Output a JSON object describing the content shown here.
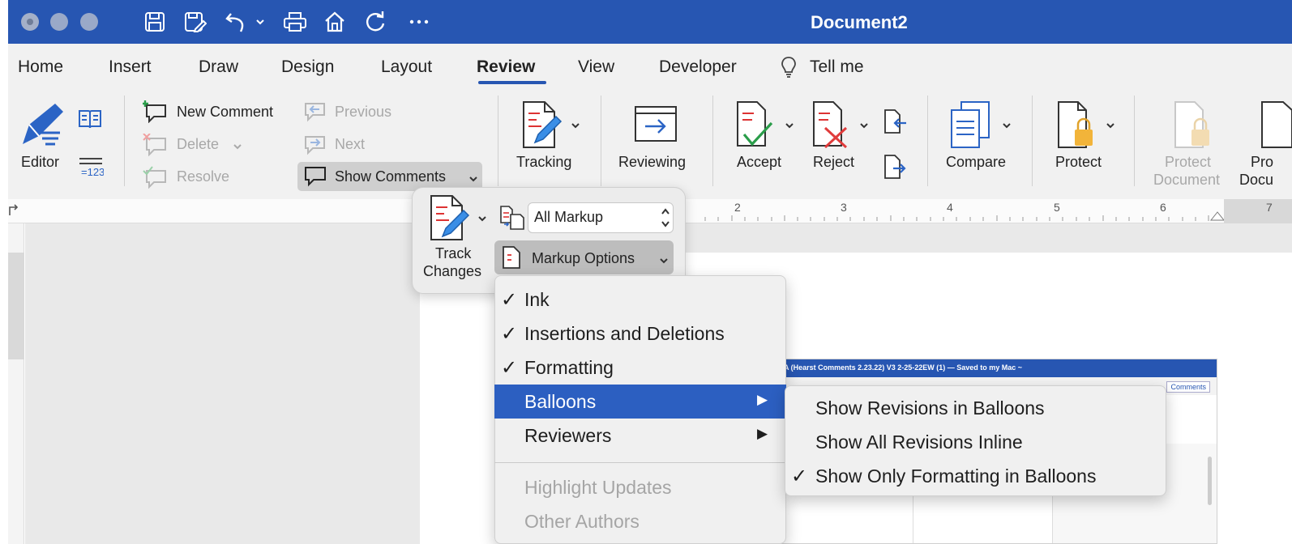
{
  "window": {
    "title": "Document2"
  },
  "quick_access": [
    "save-icon",
    "save-as-icon",
    "undo-icon",
    "undo-dropdown-icon",
    "print-icon",
    "home-icon",
    "redo-icon",
    "more-icon"
  ],
  "tabs": [
    {
      "label": "Home"
    },
    {
      "label": "Insert"
    },
    {
      "label": "Draw"
    },
    {
      "label": "Design"
    },
    {
      "label": "Layout"
    },
    {
      "label": "Review",
      "active": true
    },
    {
      "label": "View"
    },
    {
      "label": "Developer"
    },
    {
      "label": "Tell me"
    }
  ],
  "ribbon": {
    "editor": "Editor",
    "new_comment": "New Comment",
    "delete": "Delete",
    "resolve": "Resolve",
    "previous": "Previous",
    "next": "Next",
    "show_comments": "Show Comments",
    "tracking": "Tracking",
    "reviewing": "Reviewing",
    "accept": "Accept",
    "reject": "Reject",
    "compare": "Compare",
    "protect": "Protect",
    "protect_document_l1": "Protect",
    "protect_document_l2": "Document",
    "cut_off_l1": "Pro",
    "cut_off_l2": "Docu"
  },
  "ruler": {
    "ticks": [
      "2",
      "3",
      "4",
      "5",
      "6",
      "7"
    ]
  },
  "tracking_popover": {
    "track_changes_l1": "Track",
    "track_changes_l2": "Changes",
    "markup_select": "All Markup",
    "markup_options": "Markup Options"
  },
  "markup_menu": [
    {
      "label": "Ink",
      "checked": true
    },
    {
      "label": "Insertions and Deletions",
      "checked": true
    },
    {
      "label": "Formatting",
      "checked": true
    },
    {
      "label": "Balloons",
      "submenu": true,
      "highlighted": true
    },
    {
      "label": "Reviewers",
      "submenu": true
    },
    {
      "label": "Highlight Updates",
      "disabled": true
    },
    {
      "label": "Other Authors",
      "disabled": true
    }
  ],
  "balloons_submenu": [
    {
      "label": "Show Revisions in Balloons",
      "checked": false
    },
    {
      "label": "Show All Revisions Inline",
      "checked": false
    },
    {
      "label": "Show Only Formatting in Balloons",
      "checked": true
    }
  ],
  "check_glyph": "✓",
  "arrow_glyph": "▶",
  "embedded_screenshot": {
    "title": "A (Hearst Comments 2.23.22) V3 2-25-22EW (1) — Saved to my Mac ~",
    "comments_button": "Comments"
  },
  "colors": {
    "accent": "#2756b2",
    "highlight": "#2c5fc1",
    "ribbon_bg": "#f1f1f1"
  }
}
